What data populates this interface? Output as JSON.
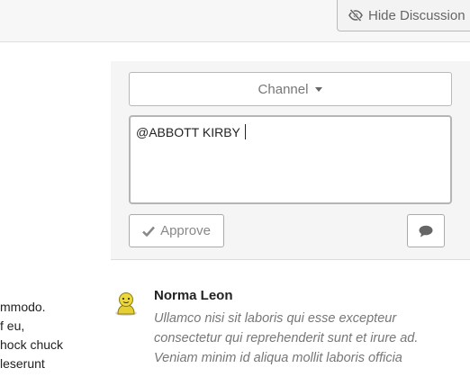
{
  "header": {
    "hide_discussion_label": "Hide Discussion"
  },
  "left_column": {
    "lines": [
      "mmodo.",
      "f eu,",
      "hock chuck",
      "leserunt"
    ]
  },
  "composer": {
    "channel_label": "Channel",
    "editor_text": "@ABBOTT KIRBY",
    "approve_label": "Approve"
  },
  "comment": {
    "author": "Norma Leon",
    "lines": [
      "Ullamco nisi sit laboris qui esse excepteur",
      "consectetur qui reprehenderit sunt et irure ad.",
      "Veniam minim id aliqua mollit laboris officia"
    ]
  },
  "icons": {
    "hide": "eye-slash-icon",
    "approve": "check-icon",
    "comment": "comment-icon",
    "avatar": "user-avatar-icon"
  }
}
